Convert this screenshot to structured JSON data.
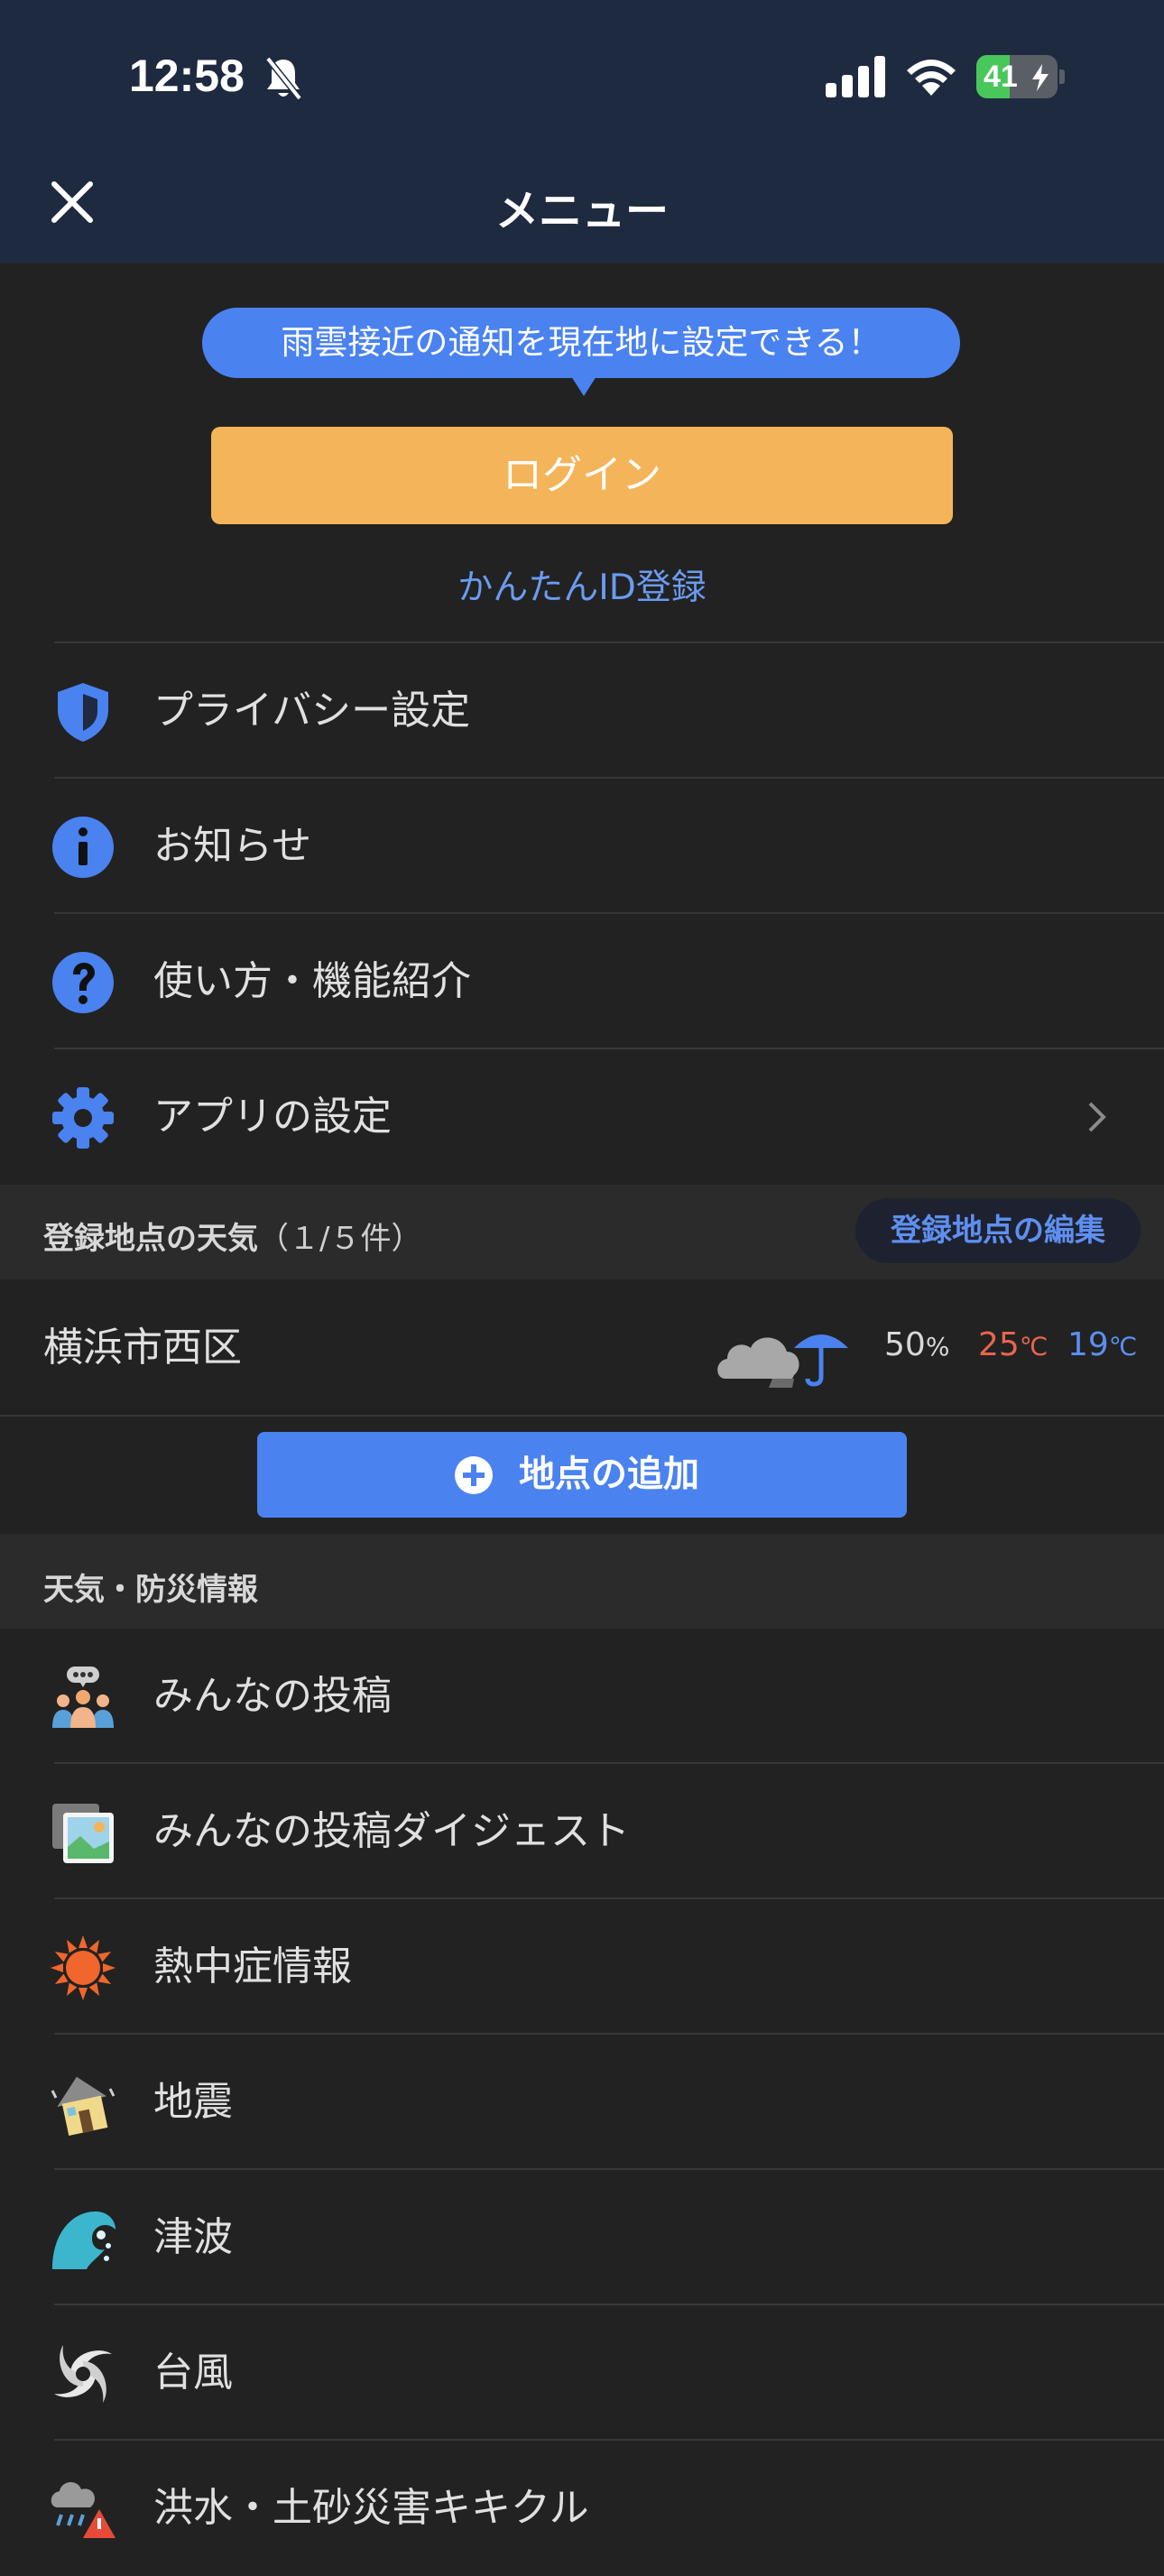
{
  "status_bar": {
    "time": "12:58",
    "battery": "41",
    "battery_level": 0.41
  },
  "header": {
    "title": "メニュー"
  },
  "notice_bubble": "雨雲接近の通知を現在地に設定できる！",
  "login_button": "ログイン",
  "register_link": "かんたんID登録",
  "menu_top": [
    {
      "label": "プライバシー設定",
      "icon": "shield-icon"
    },
    {
      "label": "お知らせ",
      "icon": "info-icon"
    },
    {
      "label": "使い方・機能紹介",
      "icon": "help-icon"
    },
    {
      "label": "アプリの設定",
      "icon": "gear-icon"
    }
  ],
  "locations_section": {
    "title": "登録地点の天気",
    "count": "（１/５件）",
    "edit_button": "登録地点の編集"
  },
  "location": {
    "name": "横浜市西区",
    "precip_value": "50",
    "precip_unit": "%",
    "temp_max": "25",
    "temp_min": "19",
    "temp_unit": "℃"
  },
  "add_location_button": "地点の追加",
  "weather_section": {
    "title": "天気・防災情報"
  },
  "menu_weather": [
    {
      "label": "みんなの投稿",
      "icon": "community-icon"
    },
    {
      "label": "みんなの投稿ダイジェスト",
      "icon": "photo-icon"
    },
    {
      "label": "熱中症情報",
      "icon": "sun-icon"
    },
    {
      "label": "地震",
      "icon": "house-icon"
    },
    {
      "label": "津波",
      "icon": "wave-icon"
    },
    {
      "label": "台風",
      "icon": "typhoon-icon"
    },
    {
      "label": "洪水・土砂災害キキクル",
      "icon": "rain-warning-icon"
    }
  ],
  "colors": {
    "header_bg": "#1e2a40",
    "accent_blue": "#4a82f0",
    "login_orange": "#f4b459",
    "temp_max": "#e8654f",
    "temp_min": "#5b8ff1"
  }
}
